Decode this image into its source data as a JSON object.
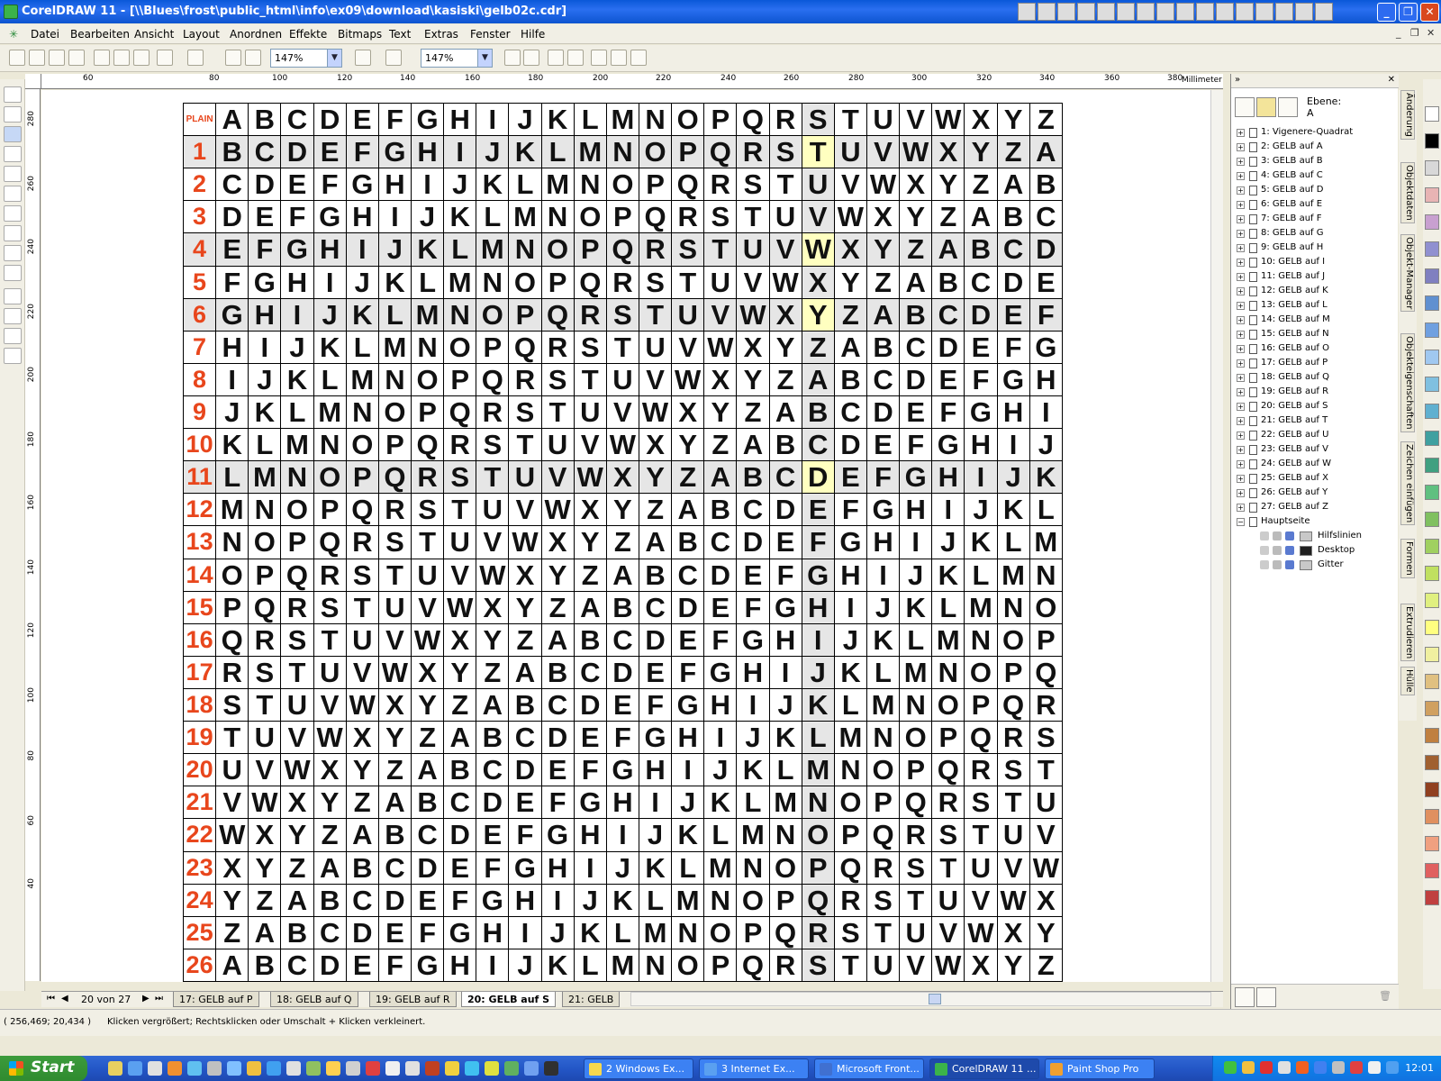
{
  "window": {
    "title": "CorelDRAW 11 - [\\\\Blues\\frost\\public_html\\info\\ex09\\download\\kasiski\\gelb02c.cdr]",
    "buttons": [
      "_",
      "❐",
      "✕"
    ]
  },
  "menu": [
    "Datei",
    "Bearbeiten",
    "Ansicht",
    "Layout",
    "Anordnen",
    "Effekte",
    "Bitmaps",
    "Text",
    "Extras",
    "Fenster",
    "Hilfe"
  ],
  "toolbar": {
    "zoom1": "147%",
    "zoom2": "147%"
  },
  "ruler": {
    "unit": "Millimeter",
    "h_labels": [
      "60",
      "80",
      "100",
      "120",
      "140",
      "160",
      "180",
      "200",
      "220",
      "240",
      "260",
      "280",
      "300",
      "320",
      "340",
      "360",
      "380"
    ],
    "v_labels": [
      "280",
      "260",
      "240",
      "220",
      "200",
      "180",
      "160",
      "140",
      "120",
      "100",
      "80",
      "60",
      "40"
    ]
  },
  "vigenere": {
    "header_label": "PLAIN",
    "alphabet": "ABCDEFGHIJKLMNOPQRSTUVWXYZ",
    "rows": 26,
    "highlight_rows": [
      1,
      4,
      6,
      11
    ],
    "highlight_column": 18
  },
  "pages": {
    "counter": "20 von 27",
    "nav": [
      "⏮",
      "◀",
      "▶",
      "⏭"
    ],
    "tabs": [
      "17: GELB auf P",
      "18: GELB auf Q",
      "19: GELB auf R",
      "20: GELB auf S",
      "21: GELB"
    ],
    "active": 3
  },
  "status": {
    "coords": "( 256,469; 20,434 )",
    "hint": "Klicken vergrößert; Rechtsklicken oder Umschalt + Klicken verkleinert."
  },
  "docker": {
    "layer_caption": "Ebene:",
    "layer_value": "A",
    "items": [
      "1: Vigenere-Quadrat",
      "2: GELB auf A",
      "3: GELB auf B",
      "4: GELB auf C",
      "5: GELB auf D",
      "6: GELB auf E",
      "7: GELB auf F",
      "8: GELB auf G",
      "9: GELB auf H",
      "10: GELB auf I",
      "11: GELB auf J",
      "12: GELB auf K",
      "13: GELB auf L",
      "14: GELB auf M",
      "15: GELB auf N",
      "16: GELB auf O",
      "17: GELB auf P",
      "18: GELB auf Q",
      "19: GELB auf R",
      "20: GELB auf S",
      "21: GELB auf T",
      "22: GELB auf U",
      "23: GELB auf V",
      "24: GELB auf W",
      "25: GELB auf X",
      "26: GELB auf Y",
      "27: GELB auf Z"
    ],
    "master": "Hauptseite",
    "master_layers": [
      "Hilfslinien",
      "Desktop",
      "Gitter"
    ],
    "side_tabs": [
      "Änderung",
      "Objektdaten",
      "Objekt-Manager",
      "Objekteigenschaften",
      "Zeichen einfügen",
      "Formen",
      "Extrudieren",
      "Hülle"
    ]
  },
  "palette": [
    "#ffffff",
    "#000000",
    "#d8d8d8",
    "#e8b4b4",
    "#c8a0d0",
    "#9090d0",
    "#8080c0",
    "#6090d0",
    "#70a0e0",
    "#a0c8f0",
    "#80c0e0",
    "#60b0d0",
    "#40a0a0",
    "#40a080",
    "#60c080",
    "#80c060",
    "#a0d060",
    "#c0e060",
    "#e0f080",
    "#ffff80",
    "#f0f0a0",
    "#e0c080",
    "#d0a060",
    "#c08040",
    "#a06030",
    "#904020",
    "#e09060",
    "#f0a080",
    "#e06060",
    "#c04040"
  ],
  "taskbar": {
    "start": "Start",
    "tasks": [
      "2 Windows Ex...",
      "3 Internet Ex...",
      "Microsoft Front...",
      "CorelDRAW 11 ...",
      "Paint Shop Pro"
    ],
    "active_task": 3,
    "clock": "12:01"
  }
}
